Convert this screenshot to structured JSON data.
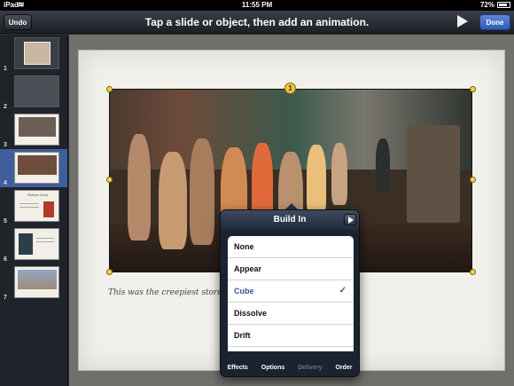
{
  "status": {
    "carrier": "iPad",
    "time": "11:55 PM",
    "battery": "72%"
  },
  "toolbar": {
    "undo": "Undo",
    "title": "Tap a slide or object, then add an animation.",
    "done": "Done"
  },
  "navigator": {
    "slides": [
      {
        "number": "1"
      },
      {
        "number": "2"
      },
      {
        "number": "3"
      },
      {
        "number": "4",
        "selected": true
      },
      {
        "number": "5"
      },
      {
        "number": "6"
      },
      {
        "number": "7"
      }
    ],
    "thumb5_title": "Rubber Duck"
  },
  "slide": {
    "caption": "This was the creepiest store we",
    "build_order": "1"
  },
  "build_in": {
    "title": "Build In",
    "options": [
      "None",
      "Appear",
      "Cube",
      "Dissolve",
      "Drift"
    ],
    "selected": "Cube",
    "tabs": [
      {
        "label": "Effects",
        "enabled": true
      },
      {
        "label": "Options",
        "enabled": true
      },
      {
        "label": "Delivery",
        "enabled": false
      },
      {
        "label": "Order",
        "enabled": true
      }
    ]
  },
  "colors": {
    "accent": "#3a5492",
    "handle": "#f4d24a",
    "done": "#3d68c2"
  }
}
